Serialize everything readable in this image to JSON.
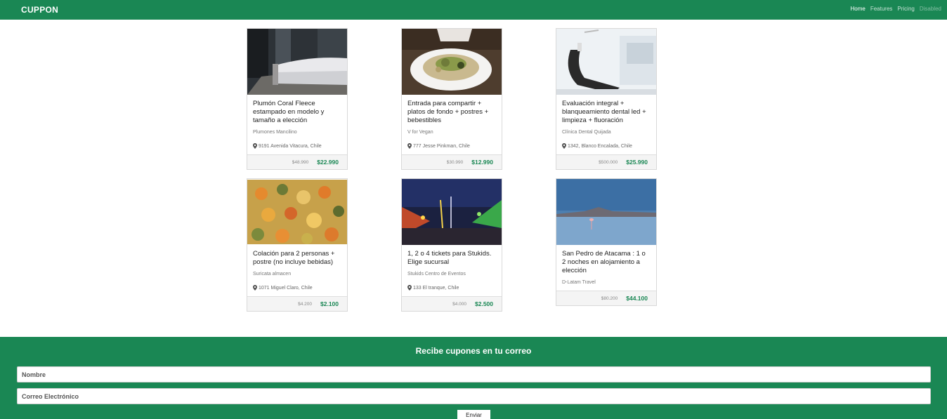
{
  "navbar": {
    "brand": "CUPPON",
    "links": [
      {
        "label": "Home",
        "state": "active"
      },
      {
        "label": "Features",
        "state": "normal"
      },
      {
        "label": "Pricing",
        "state": "normal"
      },
      {
        "label": "Disabled",
        "state": "disabled"
      }
    ]
  },
  "cards": [
    {
      "title": "Plumón Coral Fleece estampado en modelo y tamaño a elección",
      "vendor": "Plumones Mancilino",
      "address": "9191 Avenida Vitacura, Chile",
      "old_price": "$48.990",
      "new_price": "$22.990",
      "image": "bedroom-photo"
    },
    {
      "title": "Entrada para compartir + platos de fondo + postres + bebestibles",
      "vendor": "V for Vegan",
      "address": "777 Jesse Pinkman, Chile",
      "old_price": "$30.990",
      "new_price": "$12.990",
      "image": "salad-plate-photo"
    },
    {
      "title": "Evaluación integral + blanqueamiento dental led + limpieza + fluoración",
      "vendor": "Clínica Dental Quijada",
      "address": "1342, Blanco Encalada, Chile",
      "old_price": "$500.000",
      "new_price": "$25.990",
      "image": "dental-chair-photo"
    },
    {
      "title": "Colación para 2 personas + postre (no incluye bebidas)",
      "vendor": "Suricata almacen",
      "address": "1071 Miguel Claro, Chile",
      "old_price": "$4.200",
      "new_price": "$2.100",
      "image": "vegetable-dish-photo"
    },
    {
      "title": "1, 2 o 4 tickets para Stukids. Elige sucursal",
      "vendor": "Stukids Centro de Eventos",
      "address": "133 El tranque, Chile",
      "old_price": "$4.000",
      "new_price": "$2.500",
      "image": "fairground-photo"
    },
    {
      "title": "San Pedro de Atacama : 1 o 2 noches en alojamiento a elección",
      "vendor": "D-Latam Travel",
      "address": "",
      "old_price": "$80.200",
      "new_price": "$44.100",
      "image": "flamingo-lagoon-photo"
    }
  ],
  "newsletter": {
    "title": "Recibe cupones en tu correo",
    "name_placeholder": "Nombre",
    "email_placeholder": "Correo Electrónico",
    "submit_label": "Enviar"
  },
  "colors": {
    "brand": "#1a8754",
    "price": "#1a8754"
  },
  "icons": {
    "address": "map-pin-icon"
  }
}
